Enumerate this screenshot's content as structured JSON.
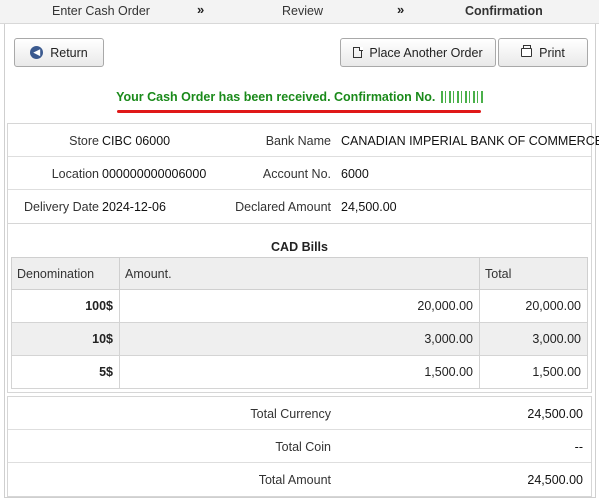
{
  "steps": {
    "step1": "Enter Cash Order",
    "step2": "Review",
    "step3": "Confirmation",
    "separator": "»"
  },
  "buttons": {
    "return_label": "Return",
    "place_another_label": "Place Another Order",
    "print_label": "Print"
  },
  "confirmation": {
    "message": "Your Cash Order has been received. Confirmation No."
  },
  "order_info": {
    "store_label": "Store",
    "store_value": "CIBC 06000",
    "bank_name_label": "Bank Name",
    "bank_name_value": "CANADIAN IMPERIAL BANK OF COMMERCE",
    "location_label": "Location",
    "location_value": "000000000006000",
    "account_label": "Account No.",
    "account_value": "6000",
    "delivery_date_label": "Delivery Date",
    "delivery_date_value": "2024-12-06",
    "declared_amount_label": "Declared Amount",
    "declared_amount_value": "24,500.00"
  },
  "bills": {
    "title": "CAD Bills",
    "columns": [
      "Denomination",
      "Amount.",
      "Total"
    ],
    "rows": [
      {
        "denomination": "100$",
        "amount": "20,000.00",
        "total": "20,000.00"
      },
      {
        "denomination": "10$",
        "amount": "3,000.00",
        "total": "3,000.00"
      },
      {
        "denomination": "5$",
        "amount": "1,500.00",
        "total": "1,500.00"
      }
    ]
  },
  "totals": {
    "currency_label": "Total Currency",
    "currency_value": "24,500.00",
    "coin_label": "Total Coin",
    "coin_value": "--",
    "amount_label": "Total Amount",
    "amount_value": "24,500.00"
  },
  "colors": {
    "confirmation_text": "#1a8a1a",
    "underline": "#e01818",
    "button_icon": "#3b5a8f"
  },
  "icons": {
    "return": "arrow-left-circle-icon",
    "place_another": "document-icon",
    "print": "printer-icon"
  }
}
